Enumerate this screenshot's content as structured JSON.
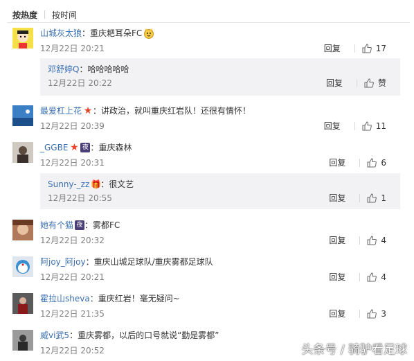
{
  "tabs": [
    {
      "label": "按热度",
      "active": true
    },
    {
      "label": "按时间",
      "active": false
    }
  ],
  "reply_label": "回复",
  "comments": [
    {
      "user": "山城灰太狼",
      "text": "重庆耙耳朵FC",
      "time": "12月22日 20:21",
      "likes": "17",
      "reply": {
        "user": "邓舒婷Q",
        "text": "哈哈哈哈哈",
        "time": "12月22日 20:22",
        "likes": "赞"
      }
    },
    {
      "user": "最爱杠上花",
      "text": "讲政治，就叫重庆红岩队！还很有情怀！",
      "time": "12月22日 20:39",
      "likes": "11"
    },
    {
      "user": "_GGBE",
      "text": "重庆森林",
      "time": "12月22日 20:31",
      "likes": "6",
      "reply": {
        "user": "Sunny-_zz",
        "text": "很文艺",
        "time": "12月22日 20:55",
        "likes": "1"
      }
    },
    {
      "user": "她有个猫",
      "text": "雾都FC",
      "time": "12月22日 20:32",
      "likes": "4"
    },
    {
      "user": "阿joy_阿joy",
      "text": "重庆山城足球队/重庆雾都足球队",
      "time": "12月22日 20:21",
      "likes": "4"
    },
    {
      "user": "霍拉山sheva",
      "text": "重庆红岩！毫无疑问~",
      "time": "12月22日 21:35",
      "likes": "3"
    },
    {
      "user": "威vi武5",
      "text": "重庆雾都，以后的口号就说“勤是雾都”",
      "time": "12月22日 20:52",
      "likes": ""
    }
  ],
  "watermark": "头条号 / 骑驴看足球",
  "colors": {
    "username": "#3a6fb0",
    "reply_bg": "#f2f2f5",
    "time": "#808080"
  }
}
